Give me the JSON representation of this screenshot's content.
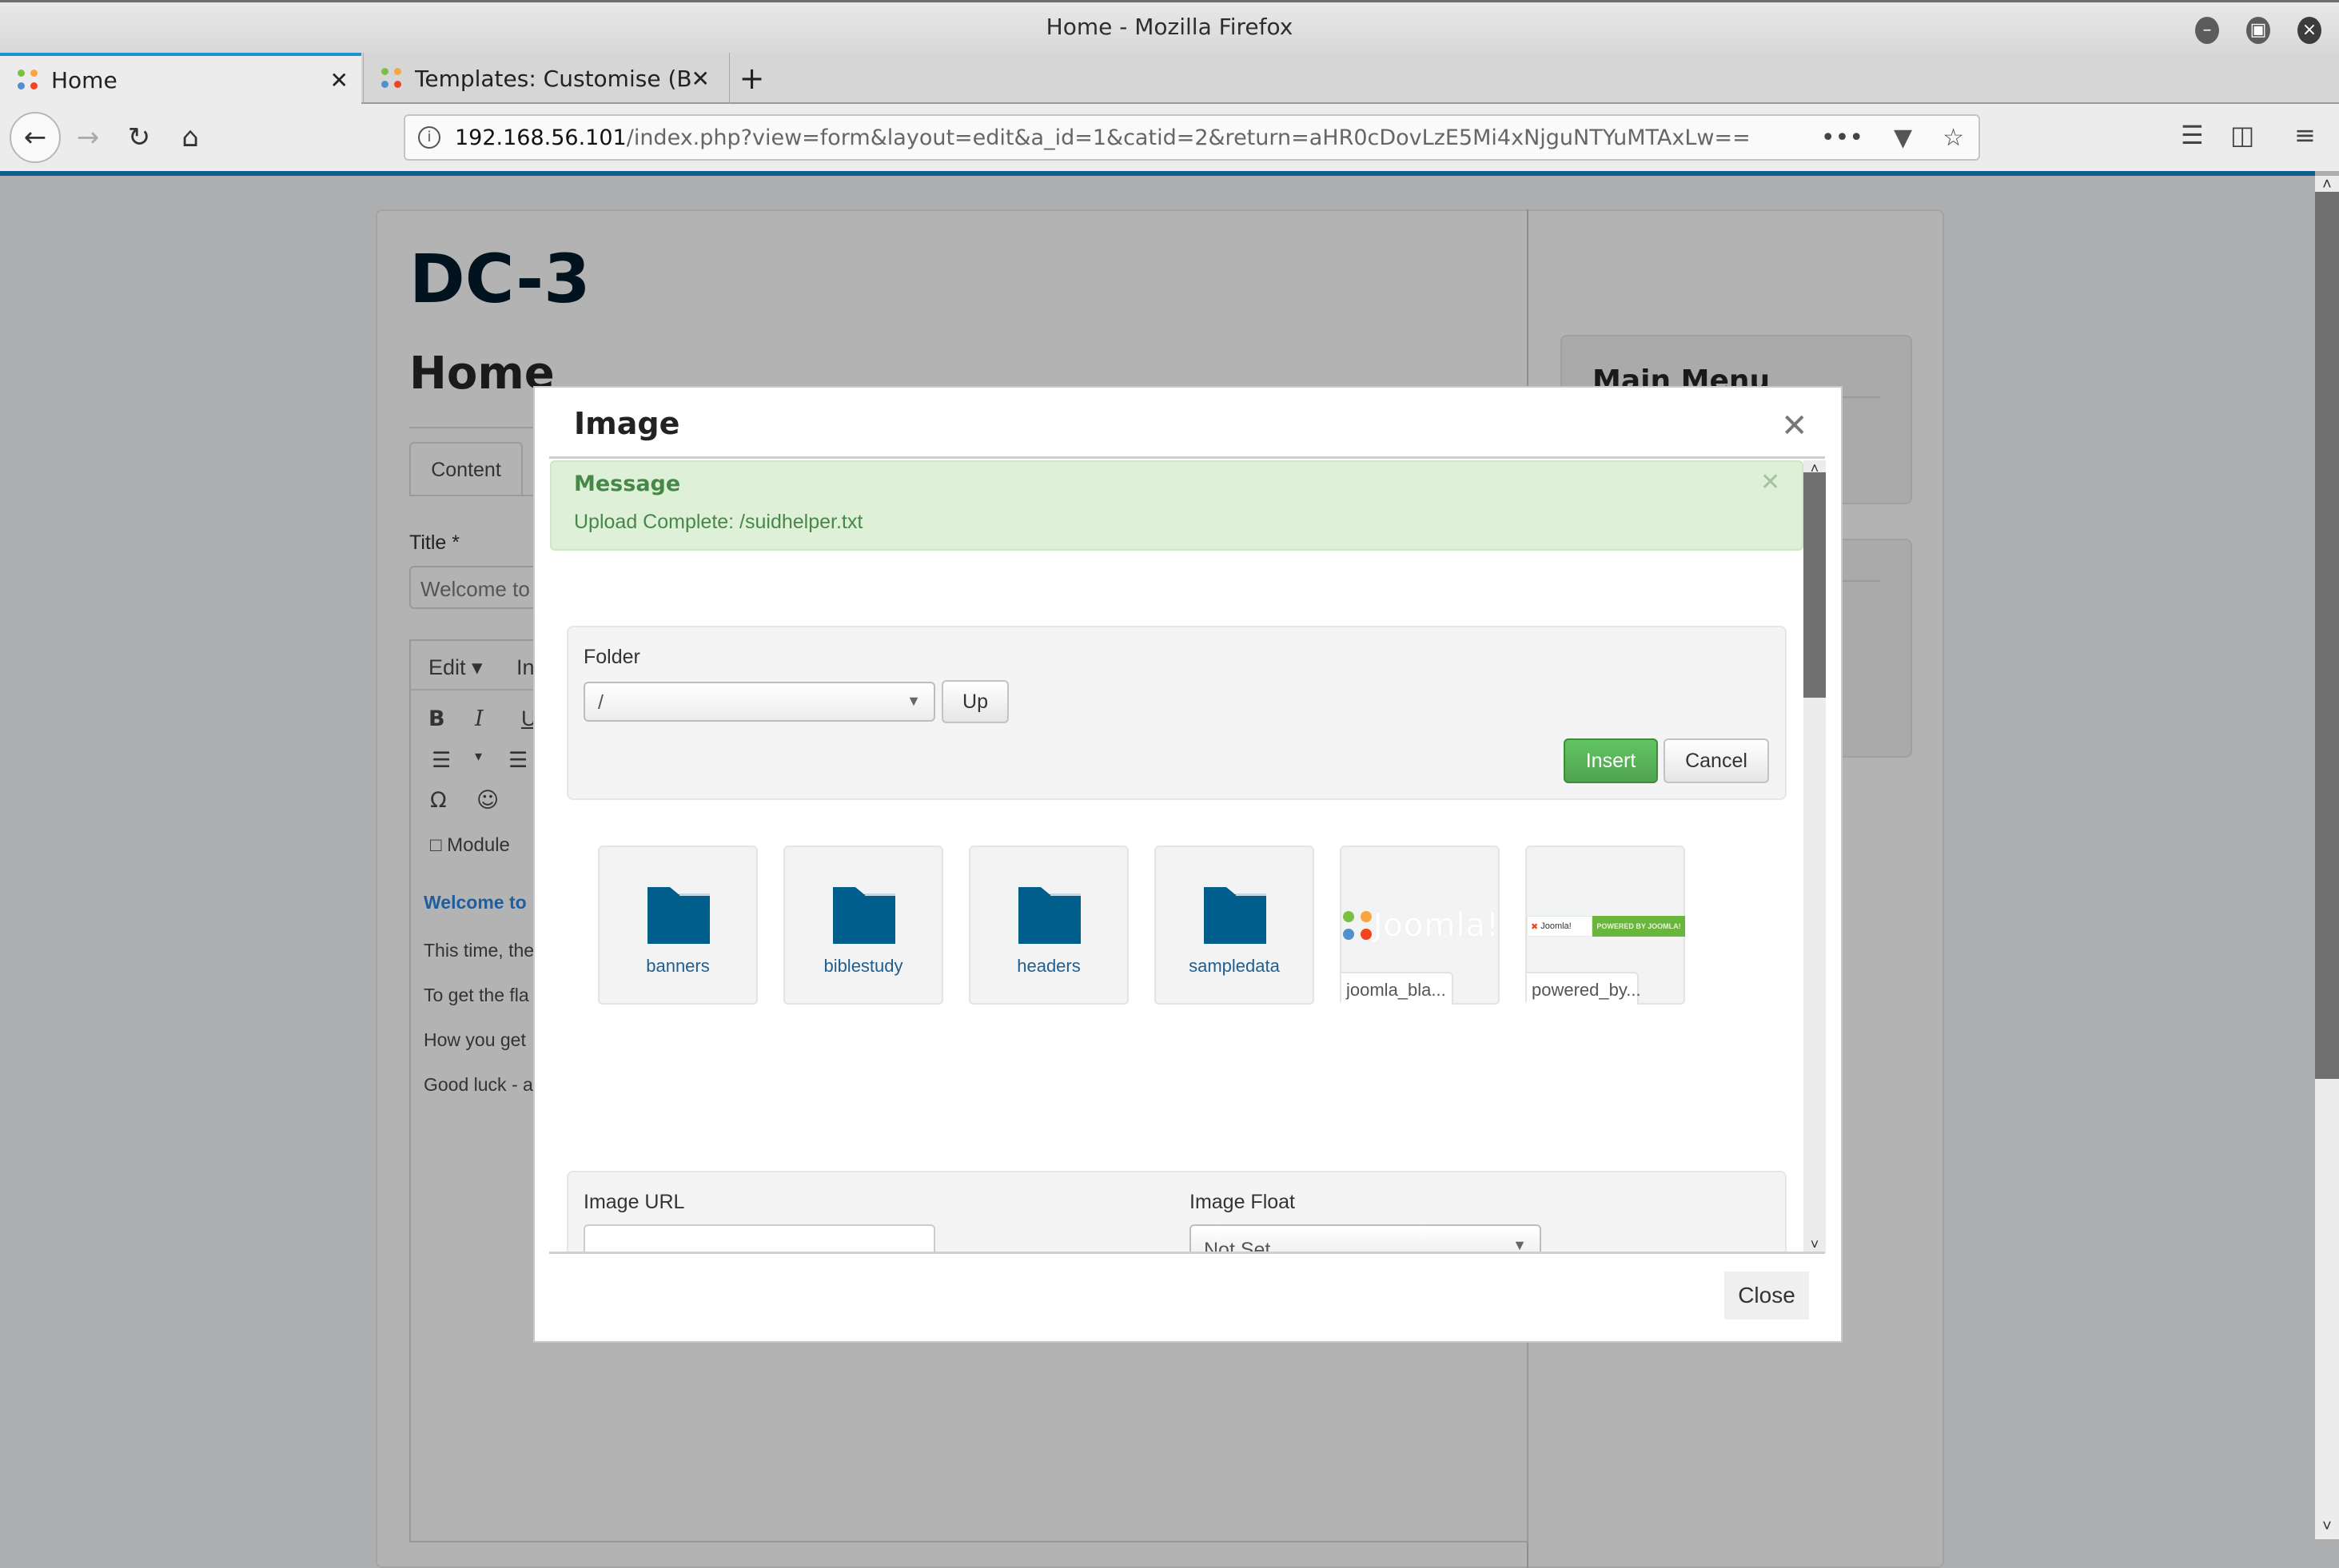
{
  "window": {
    "title": "Home - Mozilla Firefox",
    "controls": [
      "minimize",
      "maximize",
      "close"
    ]
  },
  "tabs": [
    {
      "label": "Home",
      "active": true,
      "icon": "joomla-favicon"
    },
    {
      "label": "Templates: Customise (B",
      "active": false,
      "icon": "joomla-favicon"
    }
  ],
  "new_tab_label": "+",
  "navbar": {
    "url_host": "192.168.56.101",
    "url_path": "/index.php?view=form&layout=edit&a_id=1&catid=2&return=aHR0cDovLzE5Mi4xNjguNTYuMTAxLw==",
    "page_actions_label": "•••",
    "icons": [
      "back-icon",
      "forward-icon",
      "reload-icon",
      "home-icon",
      "info-icon",
      "pocket-icon",
      "bookmark-star-icon",
      "library-icon",
      "sidebar-icon",
      "hamburger-menu-icon"
    ]
  },
  "page": {
    "site_title": "DC-3",
    "heading": "Home",
    "tab_content": "Content",
    "title_label": "Title *",
    "title_value": "Welcome to",
    "editor": {
      "menu_edit": "Edit ▾",
      "menu_insert": "In",
      "module_button": "Module",
      "body_lines": [
        "Welcome to",
        "This time, the",
        "To get the fla",
        "How you get",
        "Good luck - a"
      ]
    },
    "sidebar_title": "Main Menu"
  },
  "modal": {
    "title": "Image",
    "close_glyph": "✕",
    "alert": {
      "heading": "Message",
      "text": "Upload Complete: /suidhelper.txt",
      "close_glyph": "✕"
    },
    "folder_label": "Folder",
    "folder_value": "/",
    "up_label": "Up",
    "insert_label": "Insert",
    "cancel_label": "Cancel",
    "items": [
      {
        "type": "folder",
        "name": "banners"
      },
      {
        "type": "folder",
        "name": "biblestudy"
      },
      {
        "type": "folder",
        "name": "headers"
      },
      {
        "type": "folder",
        "name": "sampledata"
      },
      {
        "type": "image",
        "name": "joomla_bla...",
        "preview_text": "Joomla!"
      },
      {
        "type": "image",
        "name": "powered_by...",
        "preview_text": "Joomla!",
        "badge_text": "POWERED BY JOOMLA!"
      }
    ],
    "image_url_label": "Image URL",
    "image_url_value": "",
    "image_float_label": "Image Float",
    "image_float_value": "Not Set",
    "close_label": "Close"
  },
  "colors": {
    "accent_blue": "#0f5e8f",
    "folder_blue": "#005e8d",
    "success_green": "#51a351",
    "alert_bg": "#dff0d8",
    "alert_text": "#468847"
  }
}
